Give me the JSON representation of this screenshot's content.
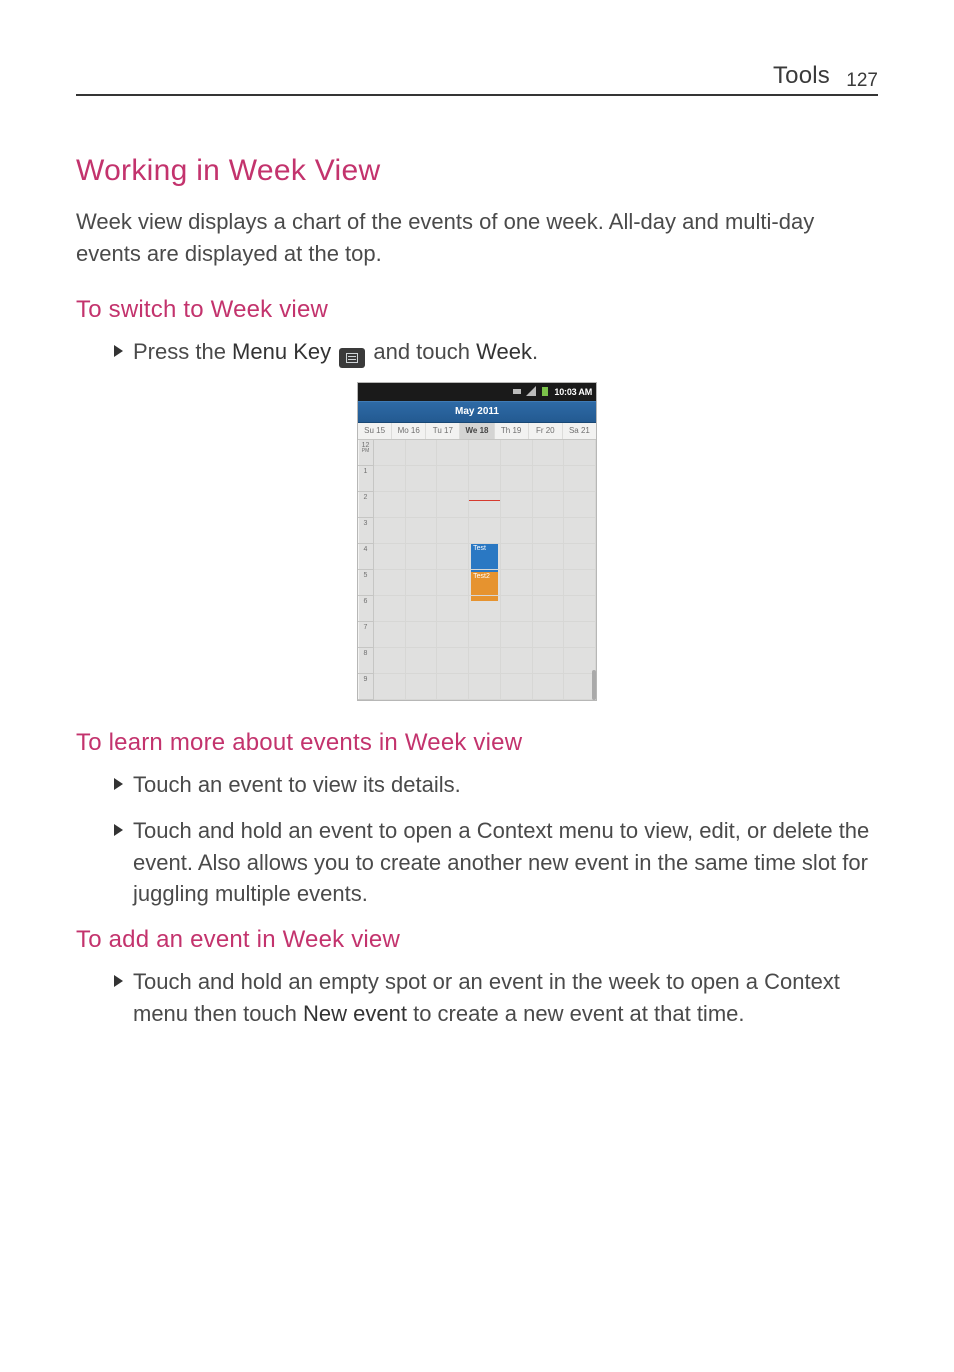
{
  "header": {
    "section": "Tools",
    "page_number": "127"
  },
  "h1": "Working in Week View",
  "intro": "Week view displays a chart of the events of one week. All-day and multi-day events are displayed at the top.",
  "h2a": "To switch to Week view",
  "step1": {
    "pre": "Press the ",
    "key_label": "Menu Key",
    "mid": " and touch ",
    "target": "Week",
    "post": "."
  },
  "screenshot": {
    "status": {
      "time": "10:03 AM"
    },
    "title": "May 2011",
    "days": [
      "Su 15",
      "Mo 16",
      "Tu 17",
      "We 18",
      "Th 19",
      "Fr 20",
      "Sa 21"
    ],
    "today_index": 3,
    "hours": [
      "12",
      "1",
      "2",
      "3",
      "4",
      "5",
      "6",
      "7",
      "8",
      "9"
    ],
    "events": {
      "blue": "Test",
      "orange": "Test2"
    }
  },
  "h2b": "To learn more about events in Week view",
  "b1": "Touch an event to view its details.",
  "b2": "Touch and hold an event to open a Context menu to view, edit, or delete the event. Also allows you to create another new event in the same time slot for juggling multiple events.",
  "h2c": "To add an event in Week view",
  "c1": {
    "pre": "Touch and hold an empty spot or an event in the week to open a Context menu then touch ",
    "bold": "New event",
    "post": " to create a new event at that time."
  }
}
